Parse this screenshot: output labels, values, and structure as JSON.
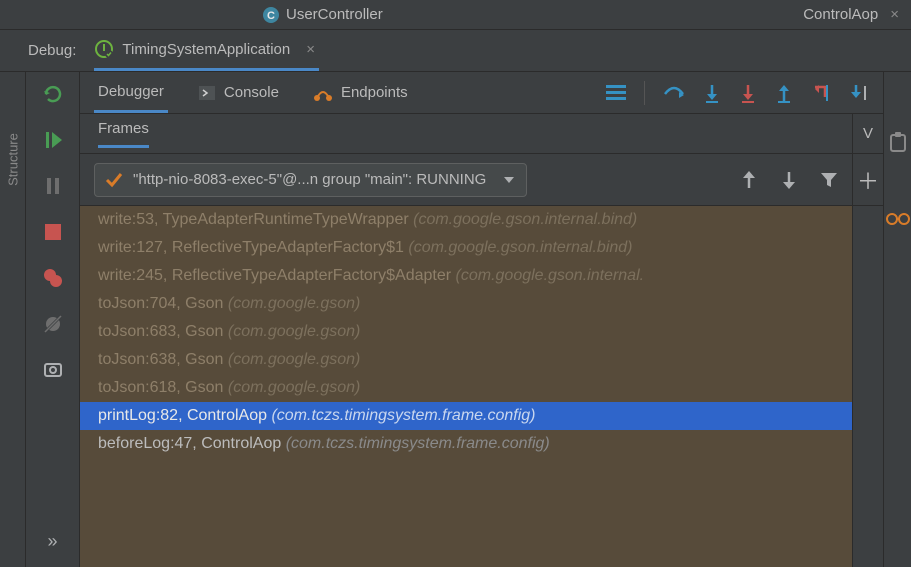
{
  "editor_tabs": {
    "left": "UserController",
    "right": "ControlAop"
  },
  "debug": {
    "label": "Debug:",
    "config_name": "TimingSystemApplication"
  },
  "debugger_tabs": {
    "debugger": "Debugger",
    "console": "Console",
    "endpoints": "Endpoints"
  },
  "frames": {
    "title": "Frames",
    "thread": "\"http-nio-8083-exec-5\"@...n group \"main\": RUNNING",
    "items": [
      {
        "method": "write",
        "line": "53",
        "class": "TypeAdapterRuntimeTypeWrapper",
        "pkg": "(com.google.gson.internal.bind)",
        "own": false
      },
      {
        "method": "write",
        "line": "127",
        "class": "ReflectiveTypeAdapterFactory$1",
        "pkg": "(com.google.gson.internal.bind)",
        "own": false
      },
      {
        "method": "write",
        "line": "245",
        "class": "ReflectiveTypeAdapterFactory$Adapter",
        "pkg": "(com.google.gson.internal.",
        "own": false
      },
      {
        "method": "toJson",
        "line": "704",
        "class": "Gson",
        "pkg": "(com.google.gson)",
        "own": false
      },
      {
        "method": "toJson",
        "line": "683",
        "class": "Gson",
        "pkg": "(com.google.gson)",
        "own": false
      },
      {
        "method": "toJson",
        "line": "638",
        "class": "Gson",
        "pkg": "(com.google.gson)",
        "own": false
      },
      {
        "method": "toJson",
        "line": "618",
        "class": "Gson",
        "pkg": "(com.google.gson)",
        "own": false
      },
      {
        "method": "printLog",
        "line": "82",
        "class": "ControlAop",
        "pkg": "(com.tczs.timingsystem.frame.config)",
        "own": true,
        "selected": true
      },
      {
        "method": "beforeLog",
        "line": "47",
        "class": "ControlAop",
        "pkg": "(com.tczs.timingsystem.frame.config)",
        "own": true
      }
    ]
  },
  "vars_panel": {
    "label_initial": "V"
  },
  "sidebar": {
    "structure": "Structure"
  }
}
